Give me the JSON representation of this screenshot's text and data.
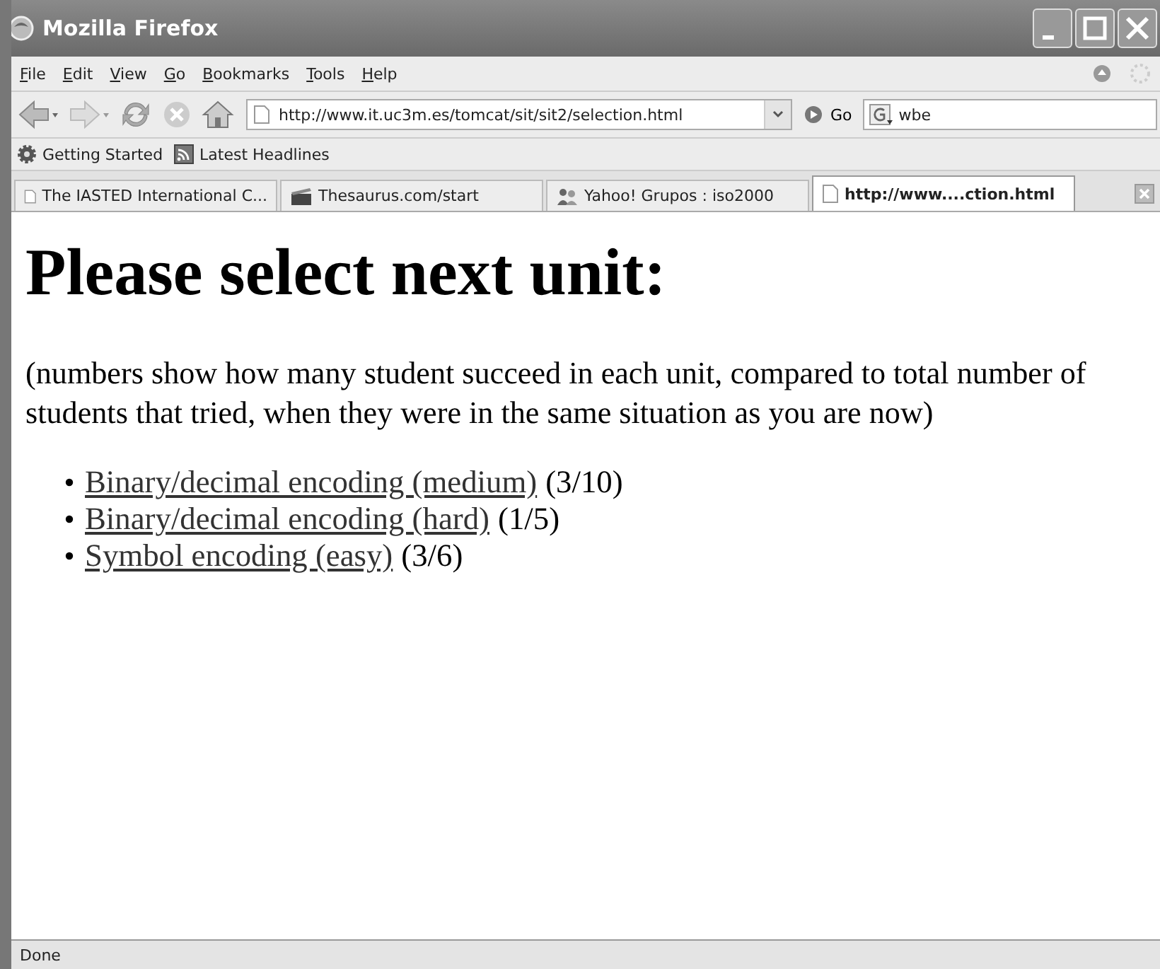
{
  "window": {
    "title": "Mozilla Firefox"
  },
  "menu": [
    "File",
    "Edit",
    "View",
    "Go",
    "Bookmarks",
    "Tools",
    "Help"
  ],
  "toolbar": {
    "url": "http://www.it.uc3m.es/tomcat/sit/sit2/selection.html",
    "go": "Go",
    "search_value": "wbe"
  },
  "bookmarks": [
    {
      "label": "Getting Started",
      "kind": "gear"
    },
    {
      "label": "Latest Headlines",
      "kind": "feed"
    }
  ],
  "tabs": [
    {
      "label": "The IASTED International C...",
      "selected": false,
      "kind": "page"
    },
    {
      "label": "Thesaurus.com/start",
      "selected": false,
      "kind": "clapper"
    },
    {
      "label": "Yahoo! Grupos : iso2000",
      "selected": false,
      "kind": "people"
    },
    {
      "label": "http://www....ction.html",
      "selected": true,
      "kind": "page"
    }
  ],
  "page": {
    "heading": "Please select next unit:",
    "intro": "(numbers show how many student succeed in each unit, compared to total number of students that tried, when they were in the same situation as you are now)",
    "units": [
      {
        "link": "Binary/decimal encoding (medium)",
        "score": "(3/10)"
      },
      {
        "link": "Binary/decimal encoding (hard)",
        "score": "(1/5)"
      },
      {
        "link": "Symbol encoding (easy)",
        "score": "(3/6)"
      }
    ]
  },
  "status_bar": "Done"
}
